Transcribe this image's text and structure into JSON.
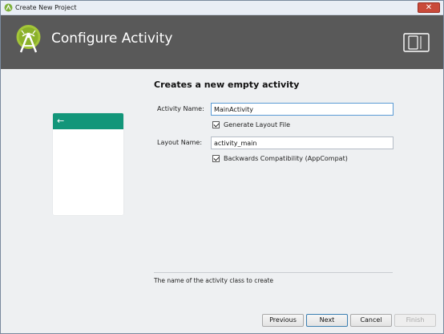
{
  "window": {
    "title": "Create New Project",
    "close_label": "✕"
  },
  "banner": {
    "heading": "Configure Activity"
  },
  "preview": {
    "back_glyph": "←",
    "bar_color": "#12967a"
  },
  "form": {
    "title": "Creates a new empty activity",
    "activity_name_label": "Activity Name:",
    "activity_name_value": "MainActivity",
    "generate_layout_label": "Generate Layout File",
    "layout_name_label": "Layout Name:",
    "layout_name_value": "activity_main",
    "backwards_compat_label": "Backwards Compatibility (AppCompat)"
  },
  "help": {
    "text": "The name of the activity class to create"
  },
  "footer": {
    "previous_label": "Previous",
    "next_label": "Next",
    "cancel_label": "Cancel",
    "finish_label": "Finish"
  },
  "colors": {
    "banner_bg": "#595959",
    "accent": "#12967a",
    "android_green": "#a4c639"
  }
}
